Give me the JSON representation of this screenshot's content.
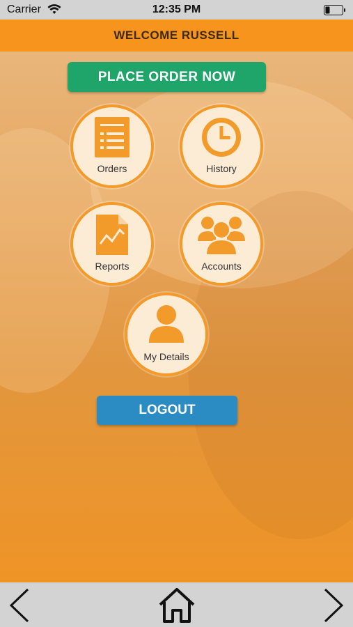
{
  "status": {
    "carrier": "Carrier",
    "time": "12:35 PM"
  },
  "header": {
    "title": "WELCOME RUSSELL"
  },
  "actions": {
    "place_order": "PLACE ORDER NOW",
    "logout": "LOGOUT"
  },
  "tiles": [
    {
      "label": "Orders",
      "icon": "document-list-icon"
    },
    {
      "label": "History",
      "icon": "clock-icon"
    },
    {
      "label": "Reports",
      "icon": "report-chart-icon"
    },
    {
      "label": "Accounts",
      "icon": "group-users-icon"
    },
    {
      "label": "My Details",
      "icon": "user-icon"
    }
  ],
  "toolbar": {
    "back": "chevron-left-icon",
    "home": "home-icon",
    "forward": "chevron-right-icon"
  },
  "colors": {
    "accent": "#f7941d",
    "green": "#1fa56a",
    "blue": "#2b8cc4",
    "tile_bg": "#fcebd5"
  }
}
